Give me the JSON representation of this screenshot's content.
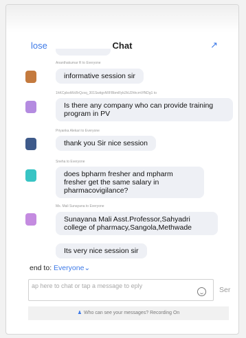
{
  "header": {
    "close_label": "lose",
    "title": "Chat",
    "share_icon": "share-icon"
  },
  "messages": [
    {
      "sender": "Ananthakumar R to Everyone",
      "text": "informative session sir",
      "avatar_color": "#c47a3e"
    },
    {
      "sender": "1hKCpbstWcBrQzxq_301SwitgrARFBbmRyb2kU2hhcmVfNDg1 to",
      "text": "Is there any company who can provide training program in PV",
      "avatar_color": "#b48be0"
    },
    {
      "sender": "Priyanka Alekari to Everyone",
      "text": "thank you Sir nice session",
      "avatar_color": "#3e5a8a"
    },
    {
      "sender": "Sneha to Everyone",
      "text": "does bpharm fresher and mpharm fresher get the same salary in pharmacovigilance?",
      "avatar_color": "#38c4c4"
    },
    {
      "sender": "Ms. Mali Sunayana to Everyone",
      "text": "Sunayana Mali Asst.Professor,Sahyadri college of pharmacy,Sangola,Methwade",
      "avatar_color": "#c48be0"
    },
    {
      "sender": "",
      "text": "Its very nice session sir",
      "avatar_color": ""
    }
  ],
  "composer": {
    "send_to_label": "end to:",
    "recipient": "Everyone",
    "chevron": "⌄",
    "placeholder": "ap here to chat or tap a message to eply",
    "send_label": "Ser"
  },
  "footer": {
    "text": "Who can see your messages? Recording On"
  },
  "colors": {
    "accent": "#3b78e7",
    "bubble": "#eef0f5"
  }
}
